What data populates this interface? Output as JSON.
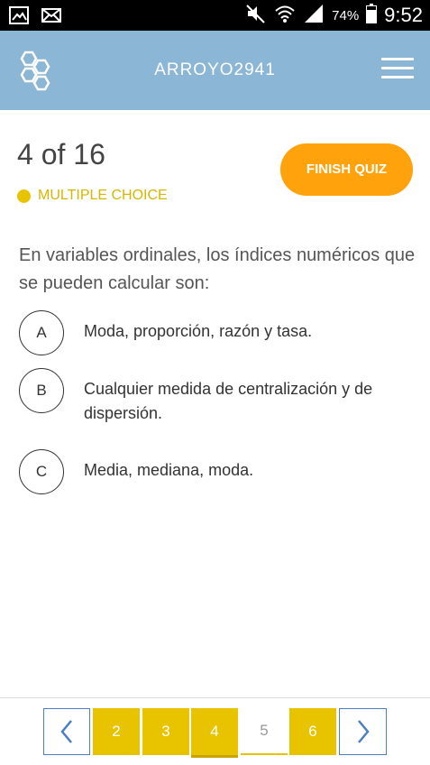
{
  "status_bar": {
    "battery_percent": "74%",
    "time": "9:52",
    "icons": [
      "image-icon",
      "mail-icon",
      "mute-icon",
      "wifi-icon",
      "signal-icon",
      "battery-icon"
    ]
  },
  "header": {
    "title": "ARROYO2941",
    "logo_icon": "hexagon-logo-icon",
    "menu_icon": "hamburger-menu-icon"
  },
  "quiz": {
    "progress": "4 of 16",
    "type_label": "MULTIPLE CHOICE",
    "finish_label": "FINISH QUIZ"
  },
  "question": {
    "text": "En variables ordinales, los índices numéricos que se pueden calcular son:"
  },
  "options": [
    {
      "letter": "A",
      "text": "Moda, proporción, razón y tasa."
    },
    {
      "letter": "B",
      "text": "Cualquier medida de centralización y de dispersión."
    },
    {
      "letter": "C",
      "text": "Media, mediana, moda."
    }
  ],
  "pagination": {
    "prev_icon": "chevron-left-icon",
    "next_icon": "chevron-right-icon",
    "pages": [
      "2",
      "3",
      "4",
      "5",
      "6"
    ],
    "current": "4"
  },
  "colors": {
    "header_bg": "#8cb6d6",
    "accent_yellow": "#e8c400",
    "finish_orange": "#ffa20c",
    "nav_blue": "#4b7fbf"
  }
}
